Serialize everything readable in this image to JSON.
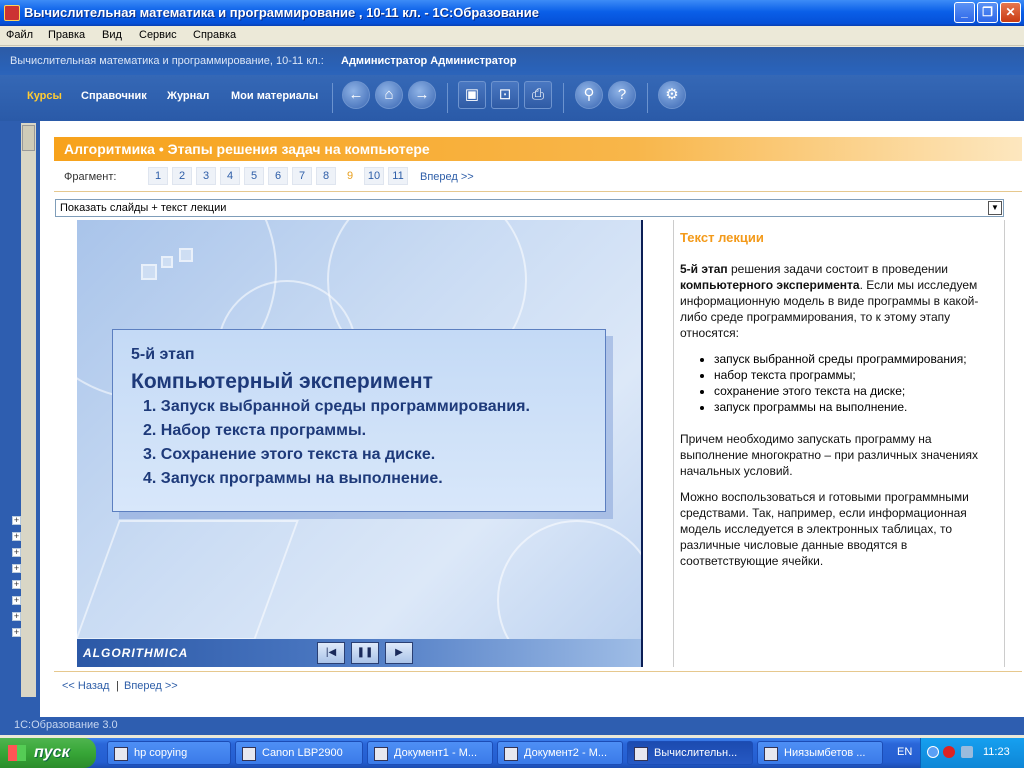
{
  "window": {
    "title": "Вычислительная математика и программирование , 10-11 кл. - 1С:Образование"
  },
  "menu": [
    "Файл",
    "Правка",
    "Вид",
    "Сервис",
    "Справка"
  ],
  "app": {
    "breadcrumb": "Вычислительная математика и программирование, 10-11 кл.:",
    "user": "Администратор Администратор",
    "tabs": [
      {
        "label": "Курсы",
        "active": true
      },
      {
        "label": "Справочник",
        "active": false
      },
      {
        "label": "Журнал",
        "active": false
      },
      {
        "label": "Мои материалы",
        "active": false
      }
    ],
    "toolbar_icons": [
      "back-icon",
      "home-icon",
      "forward-icon",
      "fullscreen-icon",
      "presentation-icon",
      "print-icon",
      "search-icon",
      "help-icon",
      "settings-icon"
    ]
  },
  "page": {
    "title": "Алгоритмика • Этапы решения задач на компьютере",
    "fragment_label": "Фрагмент:",
    "fragments": [
      "1",
      "2",
      "3",
      "4",
      "5",
      "6",
      "7",
      "8",
      "9",
      "10",
      "11"
    ],
    "current_fragment": "9",
    "next_link": "Вперед >>",
    "view_select": "Показать слайды + текст лекции"
  },
  "slide": {
    "stage": "5-й этап",
    "heading": "Компьютерный эксперимент",
    "items": [
      "1. Запуск выбранной среды программирования.",
      "2. Набор текста программы.",
      "3. Сохранение этого текста на диске.",
      "4. Запуск программы на выполнение."
    ],
    "brand": "ALGORITHMICA",
    "controls": [
      "previous-icon",
      "pause-icon",
      "play-icon"
    ]
  },
  "lecture": {
    "heading": "Текст лекции",
    "p1_bold1": "5-й этап",
    "p1_text1": " решения задачи состоит в проведении ",
    "p1_bold2": "компьютерного эксперимента",
    "p1_text2": ". Если мы исследуем информационную модель в виде программы в какой-либо среде программирования, то к этому этапу относятся:",
    "bullets": [
      "запуск выбранной среды программирования;",
      "набор текста программы;",
      "сохранение этого текста на диске;",
      "запуск программы на выполнение."
    ],
    "p2": "Причем необходимо запускать программу на выполнение многократно – при различных значениях начальных условий.",
    "p3": "Можно воспользоваться и готовыми программными средствами. Так, например, если информационная модель исследуется в электронных таблицах, то различные числовые данные вводятся в соответствующие ячейки."
  },
  "bottom_nav": {
    "back": "<< Назад",
    "sep": "|",
    "forward": "Вперед >>"
  },
  "status": "1С:Образование 3.0",
  "taskbar": {
    "start": "пуск",
    "tasks": [
      {
        "label": "hp copying",
        "active": false
      },
      {
        "label": "Canon LBP2900",
        "active": false
      },
      {
        "label": "Документ1 - М...",
        "active": false
      },
      {
        "label": "Документ2 - М...",
        "active": false
      },
      {
        "label": "Вычислительн...",
        "active": true
      },
      {
        "label": "Ниязымбетов ...",
        "active": false
      }
    ],
    "lang": "EN",
    "time": "11:23"
  }
}
